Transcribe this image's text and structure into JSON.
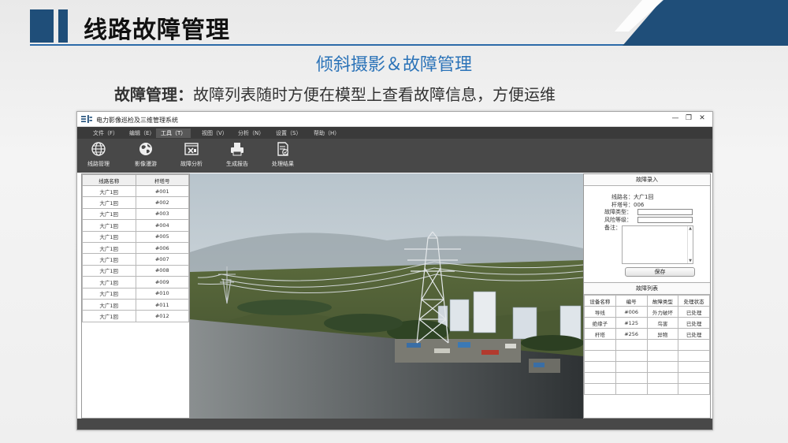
{
  "slide": {
    "title": "线路故障管理",
    "subtitle": "倾斜摄影＆故障管理",
    "desc_bold": "故障管理：",
    "desc_text": "故障列表随时方便在模型上查看故障信息，方便运维",
    "accent": "#1f4e79",
    "subtitle_color": "#2b73b8"
  },
  "app": {
    "title": "电力影像巡检及三维管理系统",
    "window_controls": [
      "—",
      "❐",
      "✕"
    ],
    "menu": [
      "文件（F）",
      "编辑（E）",
      "工具（T）",
      "视图（V）",
      "分析（N）",
      "设置（S）",
      "帮助（H）"
    ],
    "active_menu": "工具（T）",
    "toolbar": [
      {
        "label": "线路管理",
        "icon": "globe-icon"
      },
      {
        "label": "影像漫游",
        "icon": "earth-roam-icon"
      },
      {
        "label": "故障分析",
        "icon": "fault-analysis-icon"
      },
      {
        "label": "生成报告",
        "icon": "printer-icon"
      },
      {
        "label": "处理结果",
        "icon": "document-check-icon"
      }
    ]
  },
  "line_table": {
    "headers": [
      "线路名称",
      "杆塔号"
    ],
    "rows": [
      [
        "大广1回",
        "#001"
      ],
      [
        "大广1回",
        "#002"
      ],
      [
        "大广1回",
        "#003"
      ],
      [
        "大广1回",
        "#004"
      ],
      [
        "大广1回",
        "#005"
      ],
      [
        "大广1回",
        "#006"
      ],
      [
        "大广1回",
        "#007"
      ],
      [
        "大广1回",
        "#008"
      ],
      [
        "大广1回",
        "#009"
      ],
      [
        "大广1回",
        "#010"
      ],
      [
        "大广1回",
        "#011"
      ],
      [
        "大广1回",
        "#012"
      ]
    ]
  },
  "fault_entry": {
    "title": "故障录入",
    "line_name_label": "线路名：",
    "line_name_value": "大广1回",
    "tower_label": "杆塔号：",
    "tower_value": "006",
    "fault_type_label": "故障类型：",
    "risk_level_label": "风险等级：",
    "notes_label": "备注：",
    "save_label": "保存"
  },
  "fault_list": {
    "title": "故障列表",
    "headers": [
      "设备名称",
      "编号",
      "故障类型",
      "处理状态"
    ],
    "rows": [
      [
        "导线",
        "#006",
        "外力破坏",
        "已处理"
      ],
      [
        "绝缘子",
        "#125",
        "鸟害",
        "已处理"
      ],
      [
        "杆塔",
        "#256",
        "异物",
        "已处理"
      ],
      [
        "",
        "",
        "",
        ""
      ],
      [
        "",
        "",
        "",
        ""
      ],
      [
        "",
        "",
        "",
        ""
      ],
      [
        "",
        "",
        "",
        ""
      ],
      [
        "",
        "",
        "",
        ""
      ]
    ]
  }
}
